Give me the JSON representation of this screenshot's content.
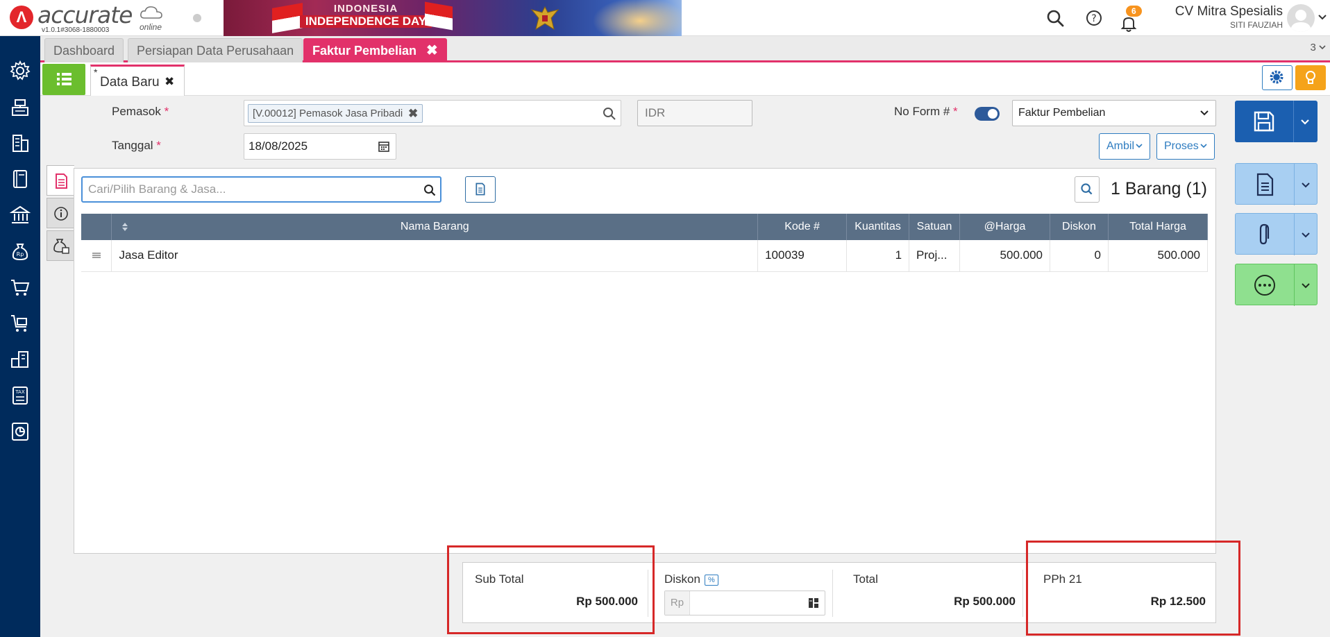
{
  "app": {
    "logo_text": "accurate",
    "logo_sub": "online",
    "version": "v1.0.1#3068-1880003",
    "banner_line1": "INDONESIA",
    "banner_line2": "INDEPENDENCE DAY"
  },
  "header": {
    "notification_count": "6",
    "company_name": "CV Mitra Spesialis",
    "user_name": "SITI FAUZIAH"
  },
  "tabs": [
    {
      "label": "Dashboard"
    },
    {
      "label": "Persiapan Data Perusahaan"
    },
    {
      "label": "Faktur Pembelian",
      "close": "✖"
    }
  ],
  "tab_count": "3",
  "subtab": {
    "marker": "*",
    "label": "Data Baru",
    "close": "✖"
  },
  "form": {
    "supplier_label": "Pemasok",
    "supplier_value": "[V.00012] Pemasok Jasa Pribadi",
    "currency": "IDR",
    "date_label": "Tanggal",
    "date_value": "18/08/2025",
    "no_form_label": "No Form #",
    "form_type": "Faktur Pembelian",
    "ambil_label": "Ambil",
    "proses_label": "Proses",
    "required_mark": "*"
  },
  "items": {
    "search_placeholder": "Cari/Pilih Barang & Jasa...",
    "count_label": "1 Barang (1)",
    "columns": [
      "Nama Barang",
      "Kode #",
      "Kuantitas",
      "Satuan",
      "@Harga",
      "Diskon",
      "Total Harga"
    ],
    "rows": [
      {
        "nama": "Jasa Editor",
        "kode": "100039",
        "kuantitas": "1",
        "satuan": "Proj...",
        "harga": "500.000",
        "diskon": "0",
        "total": "500.000"
      }
    ]
  },
  "summary": {
    "subtotal_label": "Sub Total",
    "subtotal_value": "Rp 500.000",
    "diskon_label": "Diskon",
    "diskon_pct": "%",
    "diskon_prefix": "Rp",
    "total_label": "Total",
    "total_value": "Rp 500.000",
    "pph_label": "PPh 21",
    "pph_value": "Rp 12.500"
  },
  "colors": {
    "sidebar": "#002b5c",
    "accent": "#e2316a",
    "save": "#1b5fb0",
    "attach": "#a8cff2",
    "more": "#8fe08f",
    "highlight": "#d62828"
  }
}
